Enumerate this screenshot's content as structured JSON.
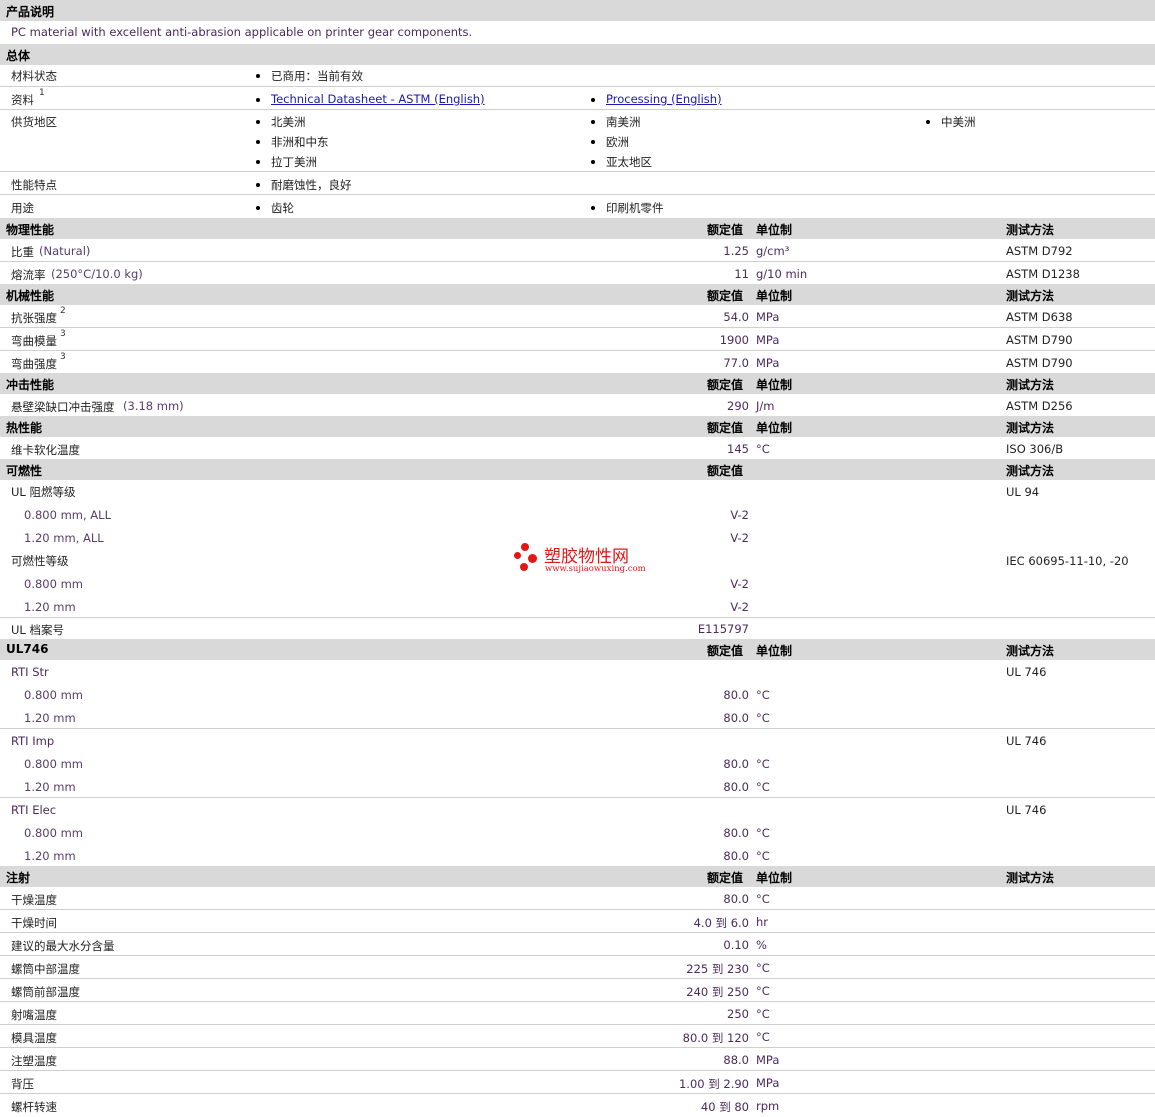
{
  "sections": {
    "desc_title": "产品说明",
    "desc_text": "PC material with excellent anti-abrasion applicable on printer gear components.",
    "general_title": "总体",
    "physical_title": "物理性能",
    "mechanical_title": "机械性能",
    "impact_title": "冲击性能",
    "thermal_title": "热性能",
    "flammability_title": "可燃性",
    "ul746_title": "UL746",
    "injection_title": "注射"
  },
  "headers": {
    "nominal": "额定值",
    "unit": "单位制",
    "method": "测试方法"
  },
  "general": {
    "status_label": "材料状态",
    "status_value": "已商用：当前有效",
    "docs_label": "资料",
    "docs_sup": "1",
    "doc1": "Technical Datasheet - ASTM (English)",
    "doc2": "Processing (English)",
    "region_label": "供货地区",
    "regions": [
      "北美洲",
      "南美洲",
      "中美洲",
      "非洲和中东",
      "欧洲",
      "拉丁美洲",
      "亚太地区"
    ],
    "features_label": "性能特点",
    "features_value": "耐磨蚀性，良好",
    "uses_label": "用途",
    "uses": [
      "齿轮",
      "印刷机零件"
    ]
  },
  "physical": [
    {
      "label": "比重",
      "cond": "(Natural)",
      "value": "1.25",
      "unit": "g/cm³",
      "method": "ASTM D792"
    },
    {
      "label": "熔流率",
      "cond": "(250°C/10.0 kg)",
      "value": "11",
      "unit": "g/10 min",
      "method": "ASTM D1238"
    }
  ],
  "mechanical": [
    {
      "label": "抗张强度",
      "sup": "2",
      "value": "54.0",
      "unit": "MPa",
      "method": "ASTM D638"
    },
    {
      "label": "弯曲模量",
      "sup": "3",
      "value": "1900",
      "unit": "MPa",
      "method": "ASTM D790"
    },
    {
      "label": "弯曲强度",
      "sup": "3",
      "value": "77.0",
      "unit": "MPa",
      "method": "ASTM D790"
    }
  ],
  "impact": [
    {
      "label": "悬壁梁缺口冲击强度",
      "cond": "(3.18 mm)",
      "value": "290",
      "unit": "J/m",
      "method": "ASTM D256"
    }
  ],
  "thermal": [
    {
      "label": "维卡软化温度",
      "value": "145",
      "unit": "°C",
      "method": "ISO 306/B"
    }
  ],
  "flammability": {
    "ul_label": "UL 阻燃等级",
    "ul_method": "UL 94",
    "ul_rows": [
      {
        "label": "0.800 mm, ALL",
        "value": "V-2"
      },
      {
        "label": "1.20 mm, ALL",
        "value": "V-2"
      }
    ],
    "fl_label": "可燃性等级",
    "fl_method": "IEC 60695-11-10, -20",
    "fl_rows": [
      {
        "label": "0.800 mm",
        "value": "V-2"
      },
      {
        "label": "1.20 mm",
        "value": "V-2"
      }
    ],
    "file_label": "UL 档案号",
    "file_value": "E115797"
  },
  "ul746": [
    {
      "label": "RTI Str",
      "method": "UL 746",
      "rows": [
        {
          "label": "0.800 mm",
          "value": "80.0",
          "unit": "°C"
        },
        {
          "label": "1.20 mm",
          "value": "80.0",
          "unit": "°C"
        }
      ]
    },
    {
      "label": "RTI Imp",
      "method": "UL 746",
      "rows": [
        {
          "label": "0.800 mm",
          "value": "80.0",
          "unit": "°C"
        },
        {
          "label": "1.20 mm",
          "value": "80.0",
          "unit": "°C"
        }
      ]
    },
    {
      "label": "RTI Elec",
      "method": "UL 746",
      "rows": [
        {
          "label": "0.800 mm",
          "value": "80.0",
          "unit": "°C"
        },
        {
          "label": "1.20 mm",
          "value": "80.0",
          "unit": "°C"
        }
      ]
    }
  ],
  "injection": [
    {
      "label": "干燥温度",
      "value": "80.0",
      "unit": "°C"
    },
    {
      "label": "干燥时间",
      "value": "4.0 到  6.0",
      "unit": "hr"
    },
    {
      "label": "建议的最大水分含量",
      "value": "0.10",
      "unit": "%"
    },
    {
      "label": "螺筒中部温度",
      "value": "225 到  230",
      "unit": "°C"
    },
    {
      "label": "螺筒前部温度",
      "value": "240 到  250",
      "unit": "°C"
    },
    {
      "label": "射嘴温度",
      "value": "250",
      "unit": "°C"
    },
    {
      "label": "模具温度",
      "value": "80.0 到  120",
      "unit": "°C"
    },
    {
      "label": "注塑温度",
      "value": "88.0",
      "unit": "MPa"
    },
    {
      "label": "背压",
      "value": "1.00 到  2.90",
      "unit": "MPa"
    },
    {
      "label": "螺杆转速",
      "value": "40 到  80",
      "unit": "rpm"
    }
  ],
  "watermark": {
    "cn": "塑胶物性网",
    "url": "www.sujiaowuxing.com"
  }
}
